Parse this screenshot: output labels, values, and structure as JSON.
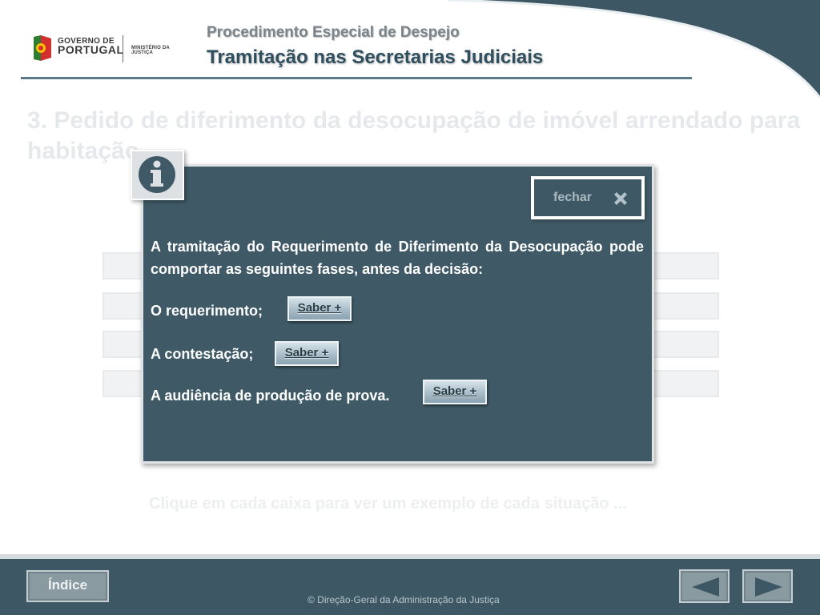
{
  "header": {
    "logo_gov_line1": "GOVERNO DE",
    "logo_gov_line2": "PORTUGAL",
    "logo_ministry": "MINISTÉRIO DA JUSTIÇA",
    "subtitle": "Procedimento Especial de Despejo",
    "title": "Tramitação nas Secretarias Judiciais"
  },
  "background": {
    "heading": "3. Pedido de diferimento da desocupação de imóvel arrendado para habitação",
    "hint": "Clique em cada caixa para ver um exemplo de cada situação ..."
  },
  "modal": {
    "close_label": "fechar",
    "intro": "A tramitação do Requerimento de Diferimento da Desocupação pode comportar as seguintes fases, antes da decisão:",
    "phases": [
      {
        "label": "O requerimento;",
        "button": "Saber +"
      },
      {
        "label": "A contestação;",
        "button": "Saber +"
      },
      {
        "label": "A audiência de produção de prova.",
        "button": "Saber +"
      }
    ]
  },
  "footer": {
    "index_label": "Índice",
    "copyright": "©  Direção-Geral da Administração da Justiça"
  },
  "colors": {
    "panel": "#3f5a66",
    "title": "#2f4f5e",
    "band": "#3d5864"
  },
  "icons": [
    "info-icon",
    "close-x-icon",
    "previous-arrow-icon",
    "next-arrow-icon"
  ]
}
